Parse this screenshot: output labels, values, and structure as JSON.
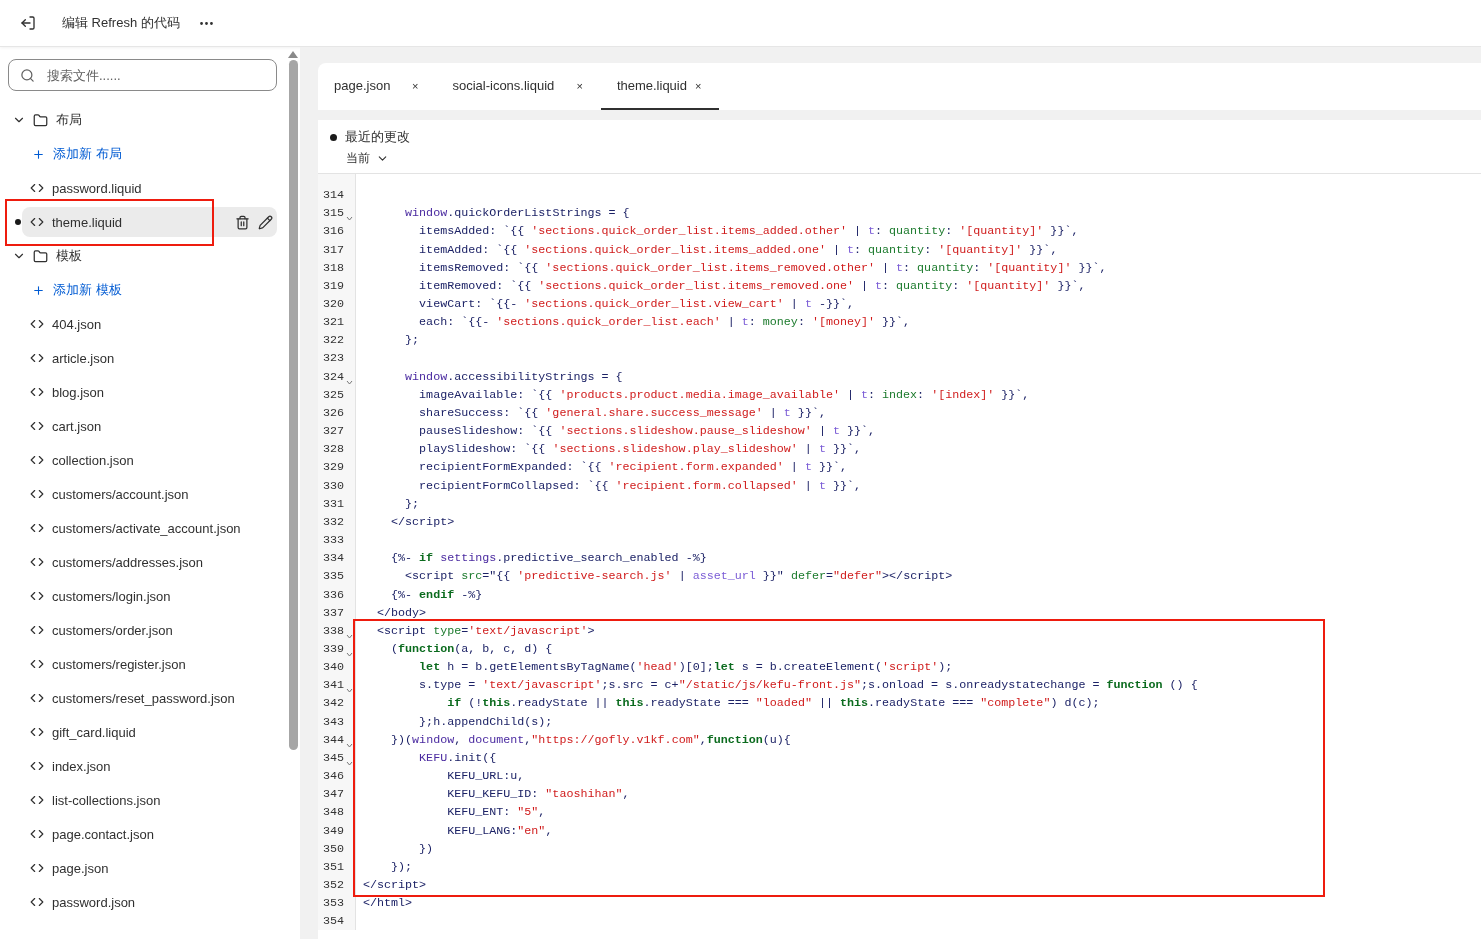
{
  "topbar": {
    "title": "编辑 Refresh 的代码"
  },
  "sidebar": {
    "search": {
      "placeholder": "搜索文件......"
    },
    "tree": [
      {
        "kind": "folder",
        "label": "布局",
        "expanded": true,
        "children": [
          {
            "kind": "add",
            "label": "添加新 布局"
          },
          {
            "kind": "file",
            "label": "password.liquid",
            "selected": false,
            "modified": false,
            "boxed": false
          },
          {
            "kind": "file",
            "label": "theme.liquid",
            "selected": true,
            "modified": true,
            "boxed": true
          }
        ]
      },
      {
        "kind": "folder",
        "label": "模板",
        "expanded": true,
        "children": [
          {
            "kind": "add",
            "label": "添加新 模板"
          },
          {
            "kind": "file",
            "label": "404.json",
            "selected": false,
            "modified": false,
            "boxed": false
          },
          {
            "kind": "file",
            "label": "article.json",
            "selected": false,
            "modified": false,
            "boxed": false
          },
          {
            "kind": "file",
            "label": "blog.json",
            "selected": false,
            "modified": false,
            "boxed": false
          },
          {
            "kind": "file",
            "label": "cart.json",
            "selected": false,
            "modified": false,
            "boxed": false
          },
          {
            "kind": "file",
            "label": "collection.json",
            "selected": false,
            "modified": false,
            "boxed": false
          },
          {
            "kind": "file",
            "label": "customers/account.json",
            "selected": false,
            "modified": false,
            "boxed": false
          },
          {
            "kind": "file",
            "label": "customers/activate_account.json",
            "selected": false,
            "modified": false,
            "boxed": false
          },
          {
            "kind": "file",
            "label": "customers/addresses.json",
            "selected": false,
            "modified": false,
            "boxed": false
          },
          {
            "kind": "file",
            "label": "customers/login.json",
            "selected": false,
            "modified": false,
            "boxed": false
          },
          {
            "kind": "file",
            "label": "customers/order.json",
            "selected": false,
            "modified": false,
            "boxed": false
          },
          {
            "kind": "file",
            "label": "customers/register.json",
            "selected": false,
            "modified": false,
            "boxed": false
          },
          {
            "kind": "file",
            "label": "customers/reset_password.json",
            "selected": false,
            "modified": false,
            "boxed": false
          },
          {
            "kind": "file",
            "label": "gift_card.liquid",
            "selected": false,
            "modified": false,
            "boxed": false
          },
          {
            "kind": "file",
            "label": "index.json",
            "selected": false,
            "modified": false,
            "boxed": false
          },
          {
            "kind": "file",
            "label": "list-collections.json",
            "selected": false,
            "modified": false,
            "boxed": false
          },
          {
            "kind": "file",
            "label": "page.contact.json",
            "selected": false,
            "modified": false,
            "boxed": false
          },
          {
            "kind": "file",
            "label": "page.json",
            "selected": false,
            "modified": false,
            "boxed": false
          },
          {
            "kind": "file",
            "label": "password.json",
            "selected": false,
            "modified": false,
            "boxed": false
          }
        ]
      }
    ]
  },
  "tabs": [
    {
      "label": "page.json",
      "close": "×",
      "selected": false
    },
    {
      "label": "social-icons.liquid",
      "close": "×",
      "selected": false
    },
    {
      "label": "theme.liquid",
      "close": "×",
      "selected": true
    }
  ],
  "changes": {
    "title": "最近的更改",
    "version": "当前"
  },
  "code": {
    "blocks": [
      {
        "boxed": false,
        "lines": [
          {
            "number": "314",
            "fold": false
          },
          {
            "number": "315",
            "fold": true,
            "tokens": [
              {
                "kind": "name",
                "text": "      window"
              },
              {
                "kind": "plain",
                "text": ".quickOrderListStrings = {"
              }
            ]
          },
          {
            "number": "316",
            "fold": false,
            "tokens": [
              {
                "kind": "plain",
                "text": "        itemsAdded: `{{ "
              },
              {
                "kind": "string",
                "text": "'sections.quick_order_list.items_added.other'"
              },
              {
                "kind": "plain",
                "text": " | "
              },
              {
                "kind": "filter",
                "text": "t"
              },
              {
                "kind": "plain",
                "text": ": "
              },
              {
                "kind": "arg",
                "text": "quantity"
              },
              {
                "kind": "plain",
                "text": ": "
              },
              {
                "kind": "string",
                "text": "'[quantity]'"
              },
              {
                "kind": "plain",
                "text": " }}`,"
              }
            ]
          },
          {
            "number": "317",
            "fold": false,
            "tokens": [
              {
                "kind": "plain",
                "text": "        itemAdded: `{{ "
              },
              {
                "kind": "string",
                "text": "'sections.quick_order_list.items_added.one'"
              },
              {
                "kind": "plain",
                "text": " | "
              },
              {
                "kind": "filter",
                "text": "t"
              },
              {
                "kind": "plain",
                "text": ": "
              },
              {
                "kind": "arg",
                "text": "quantity"
              },
              {
                "kind": "plain",
                "text": ": "
              },
              {
                "kind": "string",
                "text": "'[quantity]'"
              },
              {
                "kind": "plain",
                "text": " }}`,"
              }
            ]
          },
          {
            "number": "318",
            "fold": false,
            "tokens": [
              {
                "kind": "plain",
                "text": "        itemsRemoved: `{{ "
              },
              {
                "kind": "string",
                "text": "'sections.quick_order_list.items_removed.other'"
              },
              {
                "kind": "plain",
                "text": " | "
              },
              {
                "kind": "filter",
                "text": "t"
              },
              {
                "kind": "plain",
                "text": ": "
              },
              {
                "kind": "arg",
                "text": "quantity"
              },
              {
                "kind": "plain",
                "text": ": "
              },
              {
                "kind": "string",
                "text": "'[quantity]'"
              },
              {
                "kind": "plain",
                "text": " }}`,"
              }
            ]
          },
          {
            "number": "319",
            "fold": false,
            "tokens": [
              {
                "kind": "plain",
                "text": "        itemRemoved: `{{ "
              },
              {
                "kind": "string",
                "text": "'sections.quick_order_list.items_removed.one'"
              },
              {
                "kind": "plain",
                "text": " | "
              },
              {
                "kind": "filter",
                "text": "t"
              },
              {
                "kind": "plain",
                "text": ": "
              },
              {
                "kind": "arg",
                "text": "quantity"
              },
              {
                "kind": "plain",
                "text": ": "
              },
              {
                "kind": "string",
                "text": "'[quantity]'"
              },
              {
                "kind": "plain",
                "text": " }}`,"
              }
            ]
          },
          {
            "number": "320",
            "fold": false,
            "tokens": [
              {
                "kind": "plain",
                "text": "        viewCart: `{{- "
              },
              {
                "kind": "string",
                "text": "'sections.quick_order_list.view_cart'"
              },
              {
                "kind": "plain",
                "text": " | "
              },
              {
                "kind": "filter",
                "text": "t"
              },
              {
                "kind": "plain",
                "text": " -}}`,"
              }
            ]
          },
          {
            "number": "321",
            "fold": false,
            "tokens": [
              {
                "kind": "plain",
                "text": "        each: `{{- "
              },
              {
                "kind": "string",
                "text": "'sections.quick_order_list.each'"
              },
              {
                "kind": "plain",
                "text": " | "
              },
              {
                "kind": "filter",
                "text": "t"
              },
              {
                "kind": "plain",
                "text": ": "
              },
              {
                "kind": "arg",
                "text": "money"
              },
              {
                "kind": "plain",
                "text": ": "
              },
              {
                "kind": "string",
                "text": "'[money]'"
              },
              {
                "kind": "plain",
                "text": " }}`,"
              }
            ]
          },
          {
            "number": "322",
            "fold": false,
            "tokens": [
              {
                "kind": "plain",
                "text": "      };"
              }
            ]
          },
          {
            "number": "323",
            "fold": false
          },
          {
            "number": "324",
            "fold": true,
            "tokens": [
              {
                "kind": "name",
                "text": "      window"
              },
              {
                "kind": "plain",
                "text": ".accessibilityStrings = {"
              }
            ]
          },
          {
            "number": "325",
            "fold": false,
            "tokens": [
              {
                "kind": "plain",
                "text": "        imageAvailable: `{{ "
              },
              {
                "kind": "string",
                "text": "'products.product.media.image_available'"
              },
              {
                "kind": "plain",
                "text": " | "
              },
              {
                "kind": "filter",
                "text": "t"
              },
              {
                "kind": "plain",
                "text": ": "
              },
              {
                "kind": "arg",
                "text": "index"
              },
              {
                "kind": "plain",
                "text": ": "
              },
              {
                "kind": "string",
                "text": "'[index]'"
              },
              {
                "kind": "plain",
                "text": " }}`,"
              }
            ]
          },
          {
            "number": "326",
            "fold": false,
            "tokens": [
              {
                "kind": "plain",
                "text": "        shareSuccess: `{{ "
              },
              {
                "kind": "string",
                "text": "'general.share.success_message'"
              },
              {
                "kind": "plain",
                "text": " | "
              },
              {
                "kind": "filter",
                "text": "t"
              },
              {
                "kind": "plain",
                "text": " }}`,"
              }
            ]
          },
          {
            "number": "327",
            "fold": false,
            "tokens": [
              {
                "kind": "plain",
                "text": "        pauseSlideshow: `{{ "
              },
              {
                "kind": "string",
                "text": "'sections.slideshow.pause_slideshow'"
              },
              {
                "kind": "plain",
                "text": " | "
              },
              {
                "kind": "filter",
                "text": "t"
              },
              {
                "kind": "plain",
                "text": " }}`,"
              }
            ]
          },
          {
            "number": "328",
            "fold": false,
            "tokens": [
              {
                "kind": "plain",
                "text": "        playSlideshow: `{{ "
              },
              {
                "kind": "string",
                "text": "'sections.slideshow.play_slideshow'"
              },
              {
                "kind": "plain",
                "text": " | "
              },
              {
                "kind": "filter",
                "text": "t"
              },
              {
                "kind": "plain",
                "text": " }}`,"
              }
            ]
          },
          {
            "number": "329",
            "fold": false,
            "tokens": [
              {
                "kind": "plain",
                "text": "        recipientFormExpanded: `{{ "
              },
              {
                "kind": "string",
                "text": "'recipient.form.expanded'"
              },
              {
                "kind": "plain",
                "text": " | "
              },
              {
                "kind": "filter",
                "text": "t"
              },
              {
                "kind": "plain",
                "text": " }}`,"
              }
            ]
          },
          {
            "number": "330",
            "fold": false,
            "tokens": [
              {
                "kind": "plain",
                "text": "        recipientFormCollapsed: `{{ "
              },
              {
                "kind": "string",
                "text": "'recipient.form.collapsed'"
              },
              {
                "kind": "plain",
                "text": " | "
              },
              {
                "kind": "filter",
                "text": "t"
              },
              {
                "kind": "plain",
                "text": " }}`,"
              }
            ]
          },
          {
            "number": "331",
            "fold": false,
            "tokens": [
              {
                "kind": "plain",
                "text": "      };"
              }
            ]
          },
          {
            "number": "332",
            "fold": false,
            "tokens": [
              {
                "kind": "plain",
                "text": "    </script>"
              }
            ]
          },
          {
            "number": "333",
            "fold": false
          },
          {
            "number": "334",
            "fold": false,
            "tokens": [
              {
                "kind": "plain",
                "text": "    {%- "
              },
              {
                "kind": "keyword",
                "text": "if"
              },
              {
                "kind": "name",
                "text": " settings"
              },
              {
                "kind": "plain",
                "text": ".predictive_search_enabled -%}"
              }
            ]
          },
          {
            "number": "335",
            "fold": false,
            "tokens": [
              {
                "kind": "plain",
                "text": "      <script "
              },
              {
                "kind": "arg",
                "text": "src"
              },
              {
                "kind": "plain",
                "text": "=\"{{ "
              },
              {
                "kind": "string",
                "text": "'predictive-search.js'"
              },
              {
                "kind": "plain",
                "text": " | "
              },
              {
                "kind": "filter",
                "text": "asset_url"
              },
              {
                "kind": "plain",
                "text": " }}\" "
              },
              {
                "kind": "arg",
                "text": "defer"
              },
              {
                "kind": "plain",
                "text": "="
              },
              {
                "kind": "string",
                "text": "\"defer\""
              },
              {
                "kind": "plain",
                "text": "></script>"
              }
            ]
          },
          {
            "number": "336",
            "fold": false,
            "tokens": [
              {
                "kind": "plain",
                "text": "    {%- "
              },
              {
                "kind": "keyword",
                "text": "endif"
              },
              {
                "kind": "plain",
                "text": " -%}"
              }
            ]
          },
          {
            "number": "337",
            "fold": false,
            "tokens": [
              {
                "kind": "plain",
                "text": "  </body>"
              }
            ]
          }
        ]
      },
      {
        "boxed": true,
        "lines": [
          {
            "number": "338",
            "fold": true,
            "tokens": [
              {
                "kind": "plain",
                "text": "  <script "
              },
              {
                "kind": "arg",
                "text": "type"
              },
              {
                "kind": "plain",
                "text": "="
              },
              {
                "kind": "string",
                "text": "'text/javascript'"
              },
              {
                "kind": "plain",
                "text": ">"
              }
            ]
          },
          {
            "number": "339",
            "fold": true,
            "tokens": [
              {
                "kind": "plain",
                "text": "    ("
              },
              {
                "kind": "keyword",
                "text": "function"
              },
              {
                "kind": "plain",
                "text": "(a, b, c, d) {"
              }
            ]
          },
          {
            "number": "340",
            "fold": false,
            "tokens": [
              {
                "kind": "keyword",
                "text": "        let"
              },
              {
                "kind": "plain",
                "text": " h = b.getElementsByTagName("
              },
              {
                "kind": "string",
                "text": "'head'"
              },
              {
                "kind": "plain",
                "text": ")[0];"
              },
              {
                "kind": "keyword",
                "text": "let"
              },
              {
                "kind": "plain",
                "text": " s = b.createElement("
              },
              {
                "kind": "string",
                "text": "'script'"
              },
              {
                "kind": "plain",
                "text": ");"
              }
            ]
          },
          {
            "number": "341",
            "fold": true,
            "tokens": [
              {
                "kind": "plain",
                "text": "        s.type = "
              },
              {
                "kind": "string",
                "text": "'text/javascript'"
              },
              {
                "kind": "plain",
                "text": ";s.src = c+"
              },
              {
                "kind": "string",
                "text": "\"/static/js/kefu-front.js\""
              },
              {
                "kind": "plain",
                "text": ";s.onload = s.onreadystatechange = "
              },
              {
                "kind": "keyword",
                "text": "function"
              },
              {
                "kind": "plain",
                "text": " () {"
              }
            ]
          },
          {
            "number": "342",
            "fold": false,
            "tokens": [
              {
                "kind": "keyword",
                "text": "            if"
              },
              {
                "kind": "plain",
                "text": " (!"
              },
              {
                "kind": "keyword",
                "text": "this"
              },
              {
                "kind": "plain",
                "text": ".readyState || "
              },
              {
                "kind": "keyword",
                "text": "this"
              },
              {
                "kind": "plain",
                "text": ".readyState === "
              },
              {
                "kind": "string",
                "text": "\"loaded\""
              },
              {
                "kind": "plain",
                "text": " || "
              },
              {
                "kind": "keyword",
                "text": "this"
              },
              {
                "kind": "plain",
                "text": ".readyState === "
              },
              {
                "kind": "string",
                "text": "\"complete\""
              },
              {
                "kind": "plain",
                "text": ") d(c);"
              }
            ]
          },
          {
            "number": "343",
            "fold": false,
            "tokens": [
              {
                "kind": "plain",
                "text": "        };h.appendChild(s);"
              }
            ]
          },
          {
            "number": "344",
            "fold": true,
            "tokens": [
              {
                "kind": "plain",
                "text": "    })("
              },
              {
                "kind": "name",
                "text": "window"
              },
              {
                "kind": "plain",
                "text": ", "
              },
              {
                "kind": "name",
                "text": "document"
              },
              {
                "kind": "plain",
                "text": ","
              },
              {
                "kind": "string",
                "text": "\"https://gofly.v1kf.com\""
              },
              {
                "kind": "plain",
                "text": ","
              },
              {
                "kind": "keyword",
                "text": "function"
              },
              {
                "kind": "plain",
                "text": "(u){"
              }
            ]
          },
          {
            "number": "345",
            "fold": true,
            "tokens": [
              {
                "kind": "name",
                "text": "        KEFU"
              },
              {
                "kind": "plain",
                "text": ".init({"
              }
            ]
          },
          {
            "number": "346",
            "fold": false,
            "tokens": [
              {
                "kind": "plain",
                "text": "            KEFU_URL:u,"
              }
            ]
          },
          {
            "number": "347",
            "fold": false,
            "tokens": [
              {
                "kind": "plain",
                "text": "            KEFU_KEFU_ID: "
              },
              {
                "kind": "string",
                "text": "\"taoshihan\""
              },
              {
                "kind": "plain",
                "text": ","
              }
            ]
          },
          {
            "number": "348",
            "fold": false,
            "tokens": [
              {
                "kind": "plain",
                "text": "            KEFU_ENT: "
              },
              {
                "kind": "string",
                "text": "\"5\""
              },
              {
                "kind": "plain",
                "text": ","
              }
            ]
          },
          {
            "number": "349",
            "fold": false,
            "tokens": [
              {
                "kind": "plain",
                "text": "            KEFU_LANG:"
              },
              {
                "kind": "string",
                "text": "\"en\""
              },
              {
                "kind": "plain",
                "text": ","
              }
            ]
          },
          {
            "number": "350",
            "fold": false,
            "tokens": [
              {
                "kind": "plain",
                "text": "        })"
              }
            ]
          },
          {
            "number": "351",
            "fold": false,
            "tokens": [
              {
                "kind": "plain",
                "text": "    });"
              }
            ]
          },
          {
            "number": "352",
            "fold": false,
            "tokens": [
              {
                "kind": "plain",
                "text": "</script>"
              }
            ]
          }
        ]
      },
      {
        "boxed": false,
        "lines": [
          {
            "number": "353",
            "fold": false,
            "tokens": [
              {
                "kind": "plain",
                "text": "</html>"
              }
            ]
          },
          {
            "number": "354",
            "fold": false
          }
        ]
      }
    ]
  }
}
